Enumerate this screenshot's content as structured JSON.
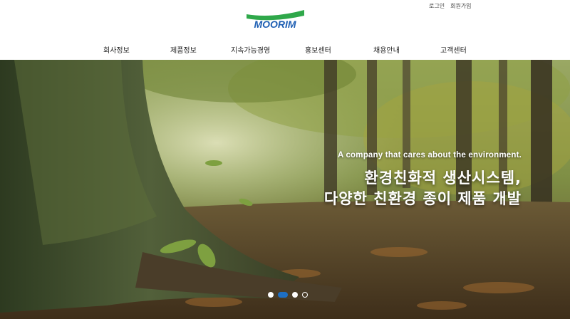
{
  "util_links": [
    "로그인",
    "회원가입"
  ],
  "logo": {
    "text": "MOORIM",
    "color": "#1e5fb3",
    "accent": "#2fa84a"
  },
  "nav": [
    "회사정보",
    "제품정보",
    "지속가능경영",
    "홍보센터",
    "채용안내",
    "고객센터"
  ],
  "hero": {
    "tagline": "A company that cares about the environment.",
    "headline_line1": "환경친화적 생산시스템,",
    "headline_line2": "다양한 친환경 종이 제품 개발"
  },
  "slider": {
    "count": 4,
    "active_index": 1
  }
}
